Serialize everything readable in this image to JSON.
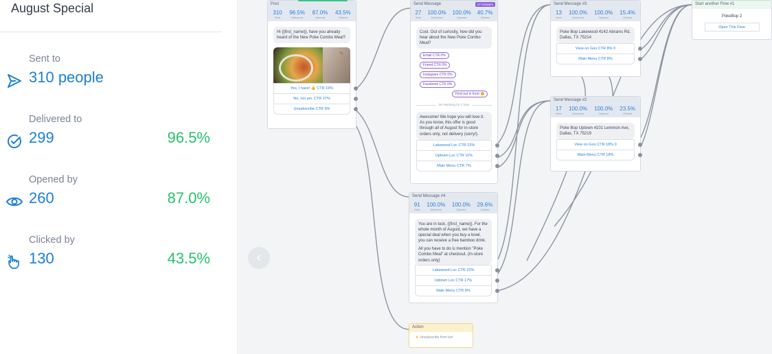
{
  "panel": {
    "title": "August Special",
    "stats": [
      {
        "label": "Sent to",
        "value": "310 people",
        "percent": "",
        "icon": "send-icon"
      },
      {
        "label": "Delivered to",
        "value": "299",
        "percent": "96.5%",
        "icon": "check-circle-icon"
      },
      {
        "label": "Opened by",
        "value": "260",
        "percent": "87.0%",
        "icon": "eye-icon"
      },
      {
        "label": "Clicked by",
        "value": "130",
        "percent": "43.5%",
        "icon": "hand-click-icon"
      }
    ]
  },
  "colors": {
    "accent_blue": "#1b7fd6",
    "accent_green": "#27c26c",
    "canvas_bg": "#f3f4f6"
  },
  "nodes": {
    "start": {
      "title": "Post",
      "stats": [
        {
          "num": "310",
          "cap": "Sent"
        },
        {
          "num": "96.5%",
          "cap": "Delivered"
        },
        {
          "num": "87.0%",
          "cap": "Opened"
        },
        {
          "num": "43.5%",
          "cap": "Clicked"
        }
      ],
      "text": "Hi {{first_name}}, have you already heard of the New Poke Combo Meal?",
      "buttons": [
        "Yes, I have! 👍 CTR 19%",
        "No, not yet. CTR 27%",
        "Unsubscribe CTR 9%"
      ]
    },
    "m1": {
      "title": "Send Message",
      "badge": "17 Answers",
      "stats": [
        {
          "num": "27",
          "cap": "Sent"
        },
        {
          "num": "100.0%",
          "cap": "Delivered"
        },
        {
          "num": "100.0%",
          "cap": "Opened"
        },
        {
          "num": "40.7%",
          "cap": "Clicked"
        }
      ],
      "text": "Cool. Out of curiosity, how did you hear about the New Poke Combo Meal?",
      "quick_replies": [
        "Email CTR 0%",
        "Friend CTR 0%",
        "Instagram CTR 0%",
        "Facebook CTR 0%"
      ],
      "qr_right": "Find out in front",
      "divider": "No Replying for 1 hour",
      "text2": "Awesome! We hope you will love it. As you know, this offer is good through all of August for in-store orders only, not delivery (sorry!).",
      "buttons": [
        "Lakewood Loc CTR 22%",
        "Uptown Loc CTR 11%",
        "Main Menu CTR 7%"
      ]
    },
    "m4": {
      "title": "Send Message #4",
      "stats": [
        {
          "num": "91",
          "cap": "Sent"
        },
        {
          "num": "100.0%",
          "cap": "Delivered"
        },
        {
          "num": "100.0%",
          "cap": "Opened"
        },
        {
          "num": "29.6%",
          "cap": "Clicked"
        }
      ],
      "text": "You are in luck, {{first_name}}. For the whole month of August, we have a special deal when you buy a bowl, you can receive a free bamboo drink.",
      "text2": "All you have to do is mention \"Poke Combo Meal\" at checkout. (In-store orders only)",
      "buttons": [
        "Lakewood Loc CTR 22%",
        "Uptown Loc CTR 17%",
        "Main Menu CTR 8%"
      ]
    },
    "m3": {
      "title": "Send Message #3",
      "stats": [
        {
          "num": "13",
          "cap": "Sent"
        },
        {
          "num": "100.0%",
          "cap": "Delivered"
        },
        {
          "num": "100.0%",
          "cap": "Opened"
        },
        {
          "num": "15.4%",
          "cap": "Clicked"
        }
      ],
      "text": "Poke Bop Lakewood 4142 Abrams Rd, Dallas, TX 75214",
      "buttons": [
        "View on Goo CTR 8% 0",
        "Main Menu CTR 8%"
      ]
    },
    "m2": {
      "title": "Send Message #2",
      "stats": [
        {
          "num": "17",
          "cap": "Sent"
        },
        {
          "num": "100.0%",
          "cap": "Delivered"
        },
        {
          "num": "100.0%",
          "cap": "Opened"
        },
        {
          "num": "23.5%",
          "cap": "Clicked"
        }
      ],
      "text": "Poke Bop Uptown 4101 Lemmon Ave, Dallas, TX 75219",
      "buttons": [
        "View on Goo CTR 18% 0",
        "Main Menu CTR 18%"
      ]
    },
    "flow": {
      "title": "Start another Flow #1",
      "name": "PokeBop 2",
      "button": "Open This Flow"
    },
    "action": {
      "title": "Action",
      "text": "Unsubscribe from bot"
    }
  },
  "canvas": {
    "back_icon": "chevron-left-icon",
    "back_symbol": "‹"
  }
}
